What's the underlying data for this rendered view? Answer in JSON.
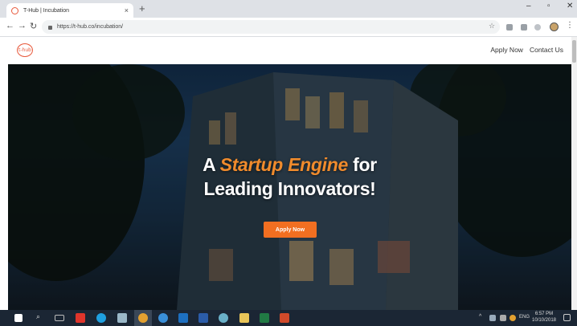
{
  "browser": {
    "tab_title": "T-Hub | Incubation",
    "tab_close": "×",
    "new_tab": "+",
    "url": "https://t-hub.co/incubation/",
    "window_controls": {
      "minimize": "–",
      "maximize": "▫",
      "close": "✕"
    }
  },
  "site": {
    "logo_text": "t-hub",
    "nav": [
      "Apply Now",
      "Contact Us"
    ]
  },
  "hero": {
    "title_prefix": "A",
    "title_accent": "Startup Engine",
    "title_suffix": "for",
    "title_line2": "Leading Innovators!",
    "cta": "Apply Now"
  },
  "taskbar": {
    "tray_lang": "ENG",
    "time": "6:57 PM",
    "date": "10/10/2018"
  },
  "colors": {
    "accent": "#f08b2c",
    "cta": "#f26f21",
    "logo": "#e8583a"
  }
}
